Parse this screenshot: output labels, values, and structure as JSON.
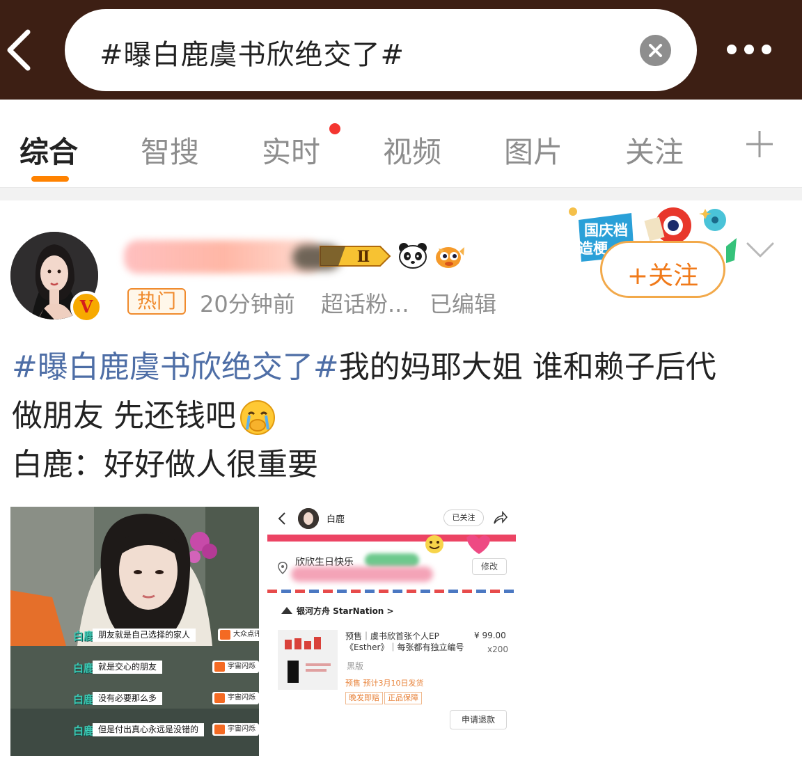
{
  "search": {
    "query": "#曝白鹿虞书欣绝交了#"
  },
  "tabs": [
    {
      "label": "综合"
    },
    {
      "label": "智搜"
    },
    {
      "label": "实时"
    },
    {
      "label": "视频"
    },
    {
      "label": "图片"
    },
    {
      "label": "关注"
    }
  ],
  "post": {
    "username": "",
    "level_badge": "Ⅱ",
    "hot_badge": "热门",
    "time": "20分钟前",
    "source": "超话粉...",
    "edited": "已编辑",
    "follow_label": "+关注",
    "decoration_text": "国庆档 造梗",
    "verify_mark": "V",
    "text_topic": "#曝白鹿虞书欣绝交了#",
    "text_line1_rest": "我的妈耶大姐 谁和赖子后代",
    "text_line2": "做朋友 先还钱吧",
    "text_line3": "白鹿：好好做人很重要"
  },
  "image1": {
    "logo": "大众点评",
    "logo2": "宇宙闪烁",
    "subtitles": [
      {
        "name": "白鹿",
        "text": "朋友就是自己选择的家人"
      },
      {
        "name": "白鹿",
        "text": "就是交心的朋友"
      },
      {
        "name": "白鹿",
        "text": "没有必要那么多"
      },
      {
        "name": "白鹿",
        "text": "但是付出真心永远是没错的"
      }
    ]
  },
  "image2": {
    "name": "白鹿",
    "followed": "已关注",
    "address": "欣欣生日快乐",
    "edit": "修改",
    "store": "银河方舟 StarNation >",
    "product_title": "预售｜虞书欣首张个人EP《Esther》｜每张都有独立编号",
    "price": "¥ 99.00",
    "quantity": "x200",
    "variant": "黑版",
    "presale_note": "预售  预计3月10日发货",
    "tags": [
      "晚发即赔",
      "正品保障"
    ],
    "refund": "申请退款"
  },
  "colors": {
    "topbar": "#3d1f14",
    "accent": "#ff8200",
    "topic": "#4e6ea6",
    "hot": "#f08a2c",
    "follow": "#f07a1a"
  }
}
